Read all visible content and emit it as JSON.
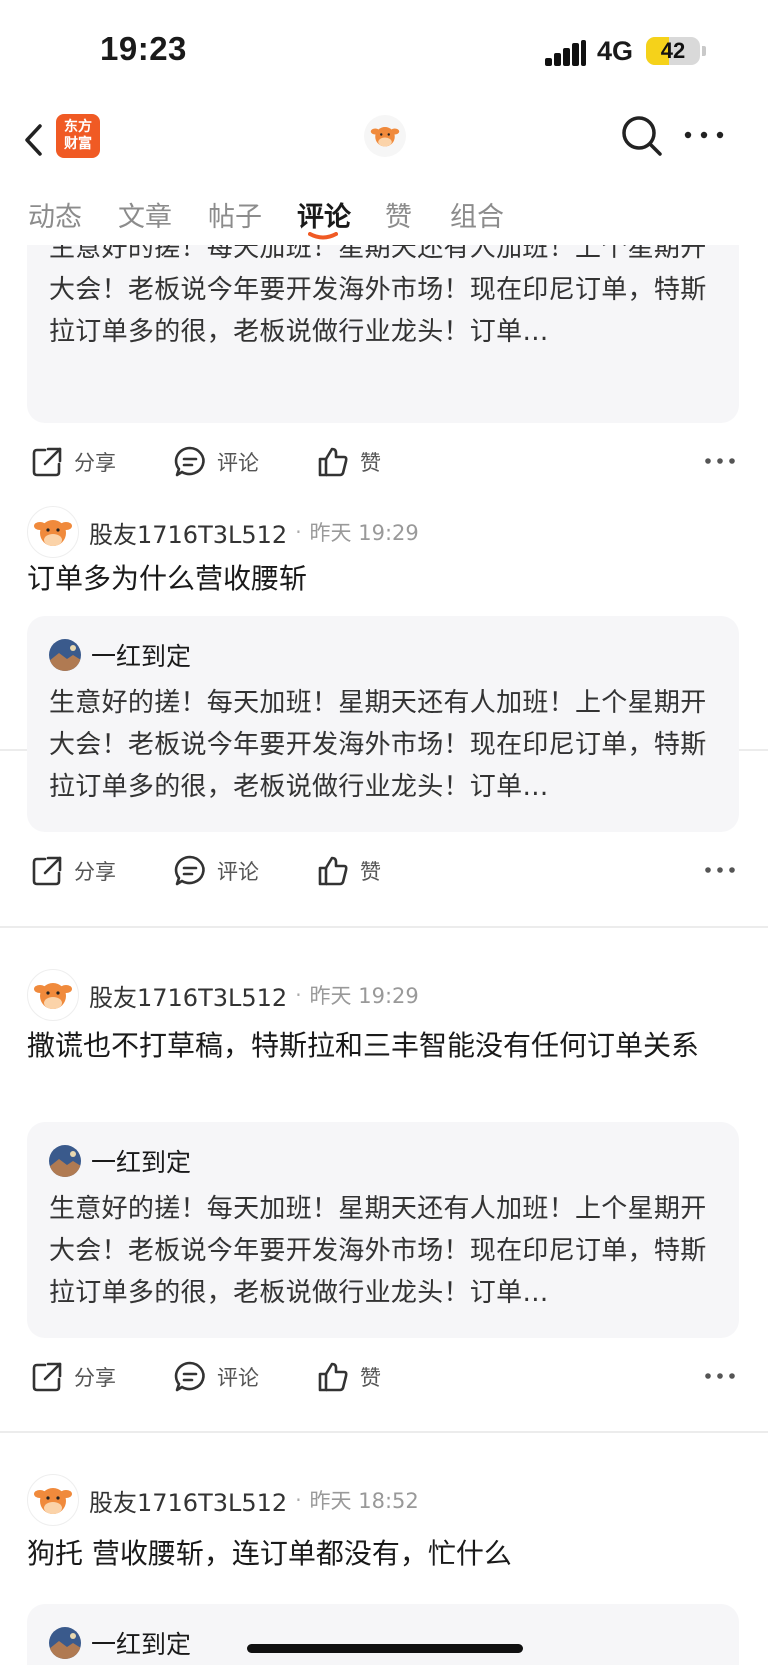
{
  "status_bar": {
    "time": "19:23",
    "network": "4G",
    "battery": "42",
    "battery_level": 0.42
  },
  "nav": {
    "logo_text_line1": "东方",
    "logo_text_line2": "财富"
  },
  "tabs": [
    {
      "label": "动态",
      "active": false
    },
    {
      "label": "文章",
      "active": false
    },
    {
      "label": "帖子",
      "active": false
    },
    {
      "label": "评论",
      "active": true
    },
    {
      "label": "赞",
      "active": false
    },
    {
      "label": "组合",
      "active": false
    }
  ],
  "actions": {
    "share": "分享",
    "comment": "评论",
    "like": "赞"
  },
  "quoted_post": {
    "author": "一红到定",
    "text": "生意好的搓！每天加班！星期天还有人加班！上个星期开大会！老板说今年要开发海外市场！现在印尼订单，特斯拉订单多的很，老板说做行业龙头！订单…"
  },
  "comments": [
    {
      "author": "股友1716T3L512",
      "time": "昨天 19:29",
      "text": "订单多为什么营收腰斩"
    },
    {
      "author": "股友1716T3L512",
      "time": "昨天 19:29",
      "text": "撒谎也不打草稿，特斯拉和三丰智能没有任何订单关系"
    },
    {
      "author": "股友1716T3L512",
      "time": "昨天 18:52",
      "text": "狗托 营收腰斩，连订单都没有，忙什么"
    }
  ],
  "separator": "·",
  "colors": {
    "brand": "#f05a24",
    "active_tab_underline": "#f05a24",
    "card_bg": "#f6f6f8"
  },
  "icons": [
    "back-icon",
    "search-icon",
    "more-icon",
    "share-icon",
    "comment-icon",
    "like-icon",
    "cow-avatar-icon"
  ]
}
